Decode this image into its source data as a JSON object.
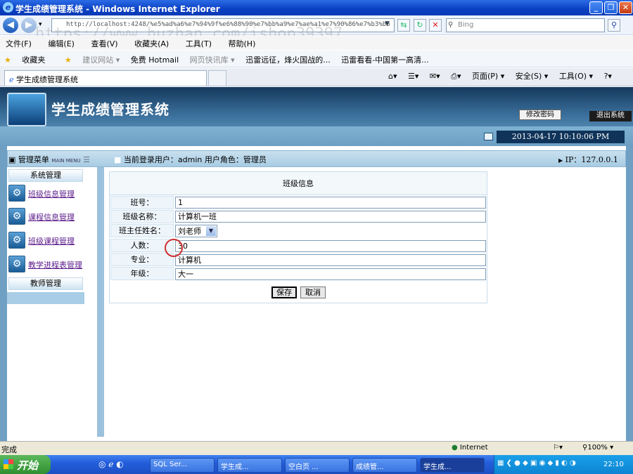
{
  "window": {
    "title": "学生成绩管理系统 - Windows Internet Explorer",
    "address": "http://localhost:4248/%e5%ad%a6%e7%94%9f%e6%88%90%e7%bb%a9%e7%ae%a1%e7%90%86%e7%b3%bb",
    "search_placeholder": "Bing",
    "watermark": "https://www.huzhan.com/ishop39397"
  },
  "menubar": [
    "文件(F)",
    "编辑(E)",
    "查看(V)",
    "收藏夹(A)",
    "工具(T)",
    "帮助(H)"
  ],
  "favorites": {
    "label": "收藏夹",
    "items": [
      "建议网站 ▾",
      "免费 Hotmail",
      "网页快讯库 ▾",
      "迅雷远征，烽火国战的...",
      "迅雷看看-中国第一高清..."
    ]
  },
  "tab": {
    "label": "学生成绩管理系统"
  },
  "commandbar": {
    "page": "页面(P) ▾",
    "safety": "安全(S) ▾",
    "tools": "工具(O) ▾",
    "help": "?▾"
  },
  "app": {
    "title": "学生成绩管理系统",
    "change_password": "修改密码",
    "logout": "退出系统",
    "datetime": "2013-04-17 10:10:06 PM",
    "menu_header": "管理菜单",
    "menu_header_en": "MAIN MENU",
    "user_info": "当前登录用户：admin 用户角色：管理员",
    "ip": "IP：127.0.0.1"
  },
  "sidebar": {
    "group1": "系统管理",
    "items": [
      "班级信息管理",
      "课程信息管理",
      "班级课程管理",
      "教学进程表管理"
    ],
    "group2": "教师管理"
  },
  "form": {
    "title": "班级信息",
    "fields": [
      {
        "label": "班号：",
        "value": "1"
      },
      {
        "label": "班级名称：",
        "value": "计算机一班"
      },
      {
        "label": "班主任姓名：",
        "value": "刘老师"
      },
      {
        "label": "人数：",
        "value": "30"
      },
      {
        "label": "专业：",
        "value": "计算机"
      },
      {
        "label": "年级：",
        "value": "大一"
      }
    ],
    "save": "保存",
    "cancel": "取消"
  },
  "statusbar": {
    "text": "完成",
    "zone": "Internet",
    "zoom": "100%"
  },
  "taskbar": {
    "start": "开始",
    "buttons": [
      "SQL Ser...",
      "学生成...",
      "空白页 ...",
      "成绩管...",
      "学生成..."
    ],
    "clock": "22:10"
  }
}
